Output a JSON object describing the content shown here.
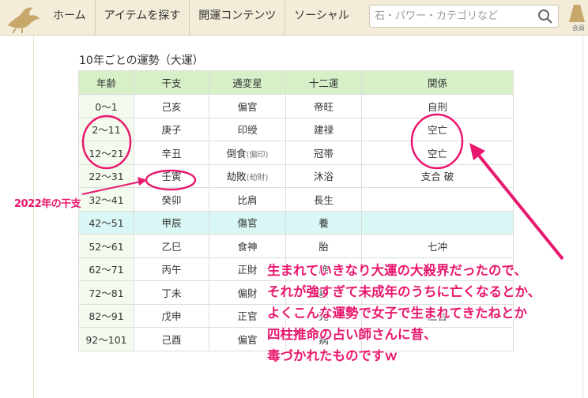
{
  "header": {
    "nav": [
      "ホーム",
      "アイテムを探す",
      "開運コンテンツ",
      "ソーシャル"
    ],
    "search_placeholder": "石・パワー・カテゴリなど",
    "member_label": "会員"
  },
  "table": {
    "caption": "10年ごとの運勢（大運）",
    "headers": [
      "年齢",
      "干支",
      "通変星",
      "十二運",
      "関係"
    ],
    "rows": [
      {
        "age": "0〜1",
        "kanshi": "己亥",
        "tsuhen": "偏官",
        "tsuhen_sub": "",
        "junun": "帝旺",
        "kankei": "自刑"
      },
      {
        "age": "2〜11",
        "kanshi": "庚子",
        "tsuhen": "印綬",
        "tsuhen_sub": "",
        "junun": "建禄",
        "kankei": "空亡"
      },
      {
        "age": "12〜21",
        "kanshi": "辛丑",
        "tsuhen": "倒食",
        "tsuhen_sub": "(偏印)",
        "junun": "冠帯",
        "kankei": "空亡"
      },
      {
        "age": "22〜31",
        "kanshi": "壬寅",
        "tsuhen": "劫敗",
        "tsuhen_sub": "(劫財)",
        "junun": "沐浴",
        "kankei": "支合 破"
      },
      {
        "age": "32〜41",
        "kanshi": "癸卯",
        "tsuhen": "比肩",
        "tsuhen_sub": "",
        "junun": "長生",
        "kankei": ""
      },
      {
        "age": "42〜51",
        "kanshi": "甲辰",
        "tsuhen": "傷官",
        "tsuhen_sub": "",
        "junun": "養",
        "kankei": ""
      },
      {
        "age": "52〜61",
        "kanshi": "乙巳",
        "tsuhen": "食神",
        "tsuhen_sub": "",
        "junun": "胎",
        "kankei": "七冲"
      },
      {
        "age": "62〜71",
        "kanshi": "丙午",
        "tsuhen": "正財",
        "tsuhen_sub": "",
        "junun": "絶",
        "kankei": ""
      },
      {
        "age": "72〜81",
        "kanshi": "丁未",
        "tsuhen": "偏財",
        "tsuhen_sub": "",
        "junun": "墓",
        "kankei": ""
      },
      {
        "age": "82〜91",
        "kanshi": "戊申",
        "tsuhen": "正官",
        "tsuhen_sub": "",
        "junun": "死",
        "kankei": "三合"
      },
      {
        "age": "92〜101",
        "kanshi": "己酉",
        "tsuhen": "偏官",
        "tsuhen_sub": "",
        "junun": "病",
        "kankei": ""
      }
    ],
    "highlight_row": 5
  },
  "annotations": {
    "label_2022": "2022年の干支",
    "comment_lines": [
      "生まれていきなり大運の大殺界だったので、",
      "それが強すぎて未成年のうちに亡くなるとか、",
      "よくこんな運勢で女子で生まれてきたねとか",
      "四柱推命の占い師さんに昔、",
      "毒づかれたものですｗ"
    ],
    "color": "#e8186e"
  }
}
